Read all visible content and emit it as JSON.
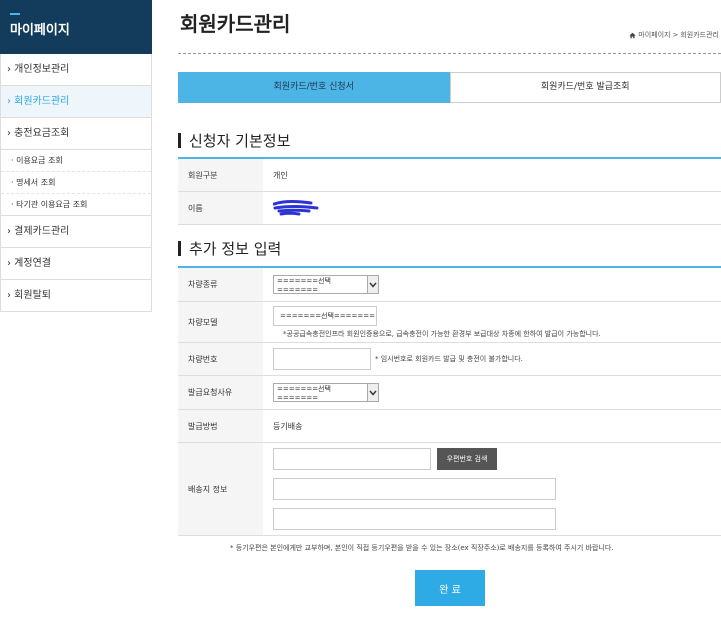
{
  "sidebar": {
    "title": "마이페이지",
    "items": [
      {
        "label": "› 개인정보관리"
      },
      {
        "label": "› 회원카드관리"
      },
      {
        "label": "› 충전요금조회"
      }
    ],
    "subitems": [
      {
        "label": "· 이용요금 조회"
      },
      {
        "label": "· 명세서 조회"
      },
      {
        "label": "· 타기관 이용요금 조회"
      }
    ],
    "items2": [
      {
        "label": "› 결제카드관리"
      },
      {
        "label": "› 계정연결"
      },
      {
        "label": "› 회원탈퇴"
      }
    ]
  },
  "header": {
    "title": "회원카드관리",
    "breadcrumb_home": "마이페이지",
    "breadcrumb_sep": ">",
    "breadcrumb_current": "회원카드관리"
  },
  "tabs": [
    {
      "label": "회원카드/번호 신청서"
    },
    {
      "label": "회원카드/번호 발급조회"
    }
  ],
  "section1": {
    "title": "신청자 기본정보",
    "member_type_label": "회원구분",
    "member_type_value": "개인",
    "name_label": "이름"
  },
  "section2": {
    "title": "추가 정보 입력",
    "vehicle_type_label": "차량종류",
    "vehicle_type_value": "=======선택=======",
    "vehicle_model_label": "차량모델",
    "vehicle_model_value": "=======선택=======",
    "vehicle_model_note": "*공공급속충전인프라 회원인증용으로, 급속충전이 가능한 환경부 보급대상 차종에 한하여 발급이 가능합니다.",
    "plate_label": "차량번호",
    "plate_note": "* 임시번호로 회원카드 발급 및 충전이 불가합니다.",
    "reason_label": "발급요청사유",
    "reason_value": "=======선택=======",
    "method_label": "발급방법",
    "method_value": "등기배송",
    "address_label": "배송지 정보",
    "zip_button": "우편번호 검색"
  },
  "bottom_note": "* 등기우편은 본인에게만 교부하며, 본인이 직접 등기우편을 받을 수 있는 장소(ex 직장주소)로 배송지를 등록하여 주시기 바랍니다.",
  "done_button": "완 료",
  "colors": {
    "sidebar_header": "#133b5c",
    "accent": "#4db4e6",
    "redaction": "#2b33d6"
  }
}
